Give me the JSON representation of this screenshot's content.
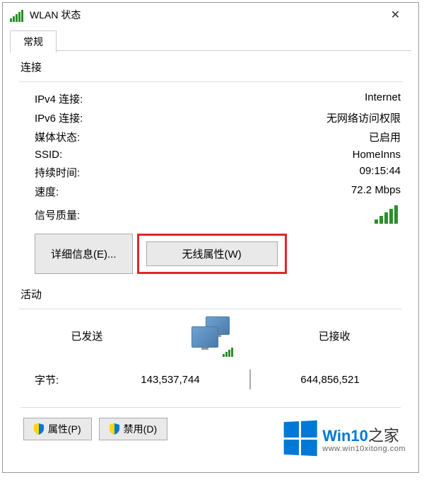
{
  "title": "WLAN 状态",
  "tab": "常规",
  "connection": {
    "heading": "连接",
    "ipv4_label": "IPv4 连接:",
    "ipv4_value": "Internet",
    "ipv6_label": "IPv6 连接:",
    "ipv6_value": "无网络访问权限",
    "media_label": "媒体状态:",
    "media_value": "已启用",
    "ssid_label": "SSID:",
    "ssid_value": "HomeInns",
    "duration_label": "持续时间:",
    "duration_value": "09:15:44",
    "speed_label": "速度:",
    "speed_value": "72.2 Mbps",
    "signal_label": "信号质量:"
  },
  "buttons": {
    "details": "详细信息(E)...",
    "wireless_props": "无线属性(W)"
  },
  "activity": {
    "heading": "活动",
    "sent": "已发送",
    "received": "已接收",
    "bytes_label": "字节:",
    "bytes_sent": "143,537,744",
    "bytes_received": "644,856,521"
  },
  "bottom_buttons": {
    "properties": "属性(P)",
    "disable": "禁用(D)"
  },
  "watermark": {
    "brand_prefix": "Win10",
    "brand_suffix": "之家",
    "url": "www.win10xitong.com"
  }
}
